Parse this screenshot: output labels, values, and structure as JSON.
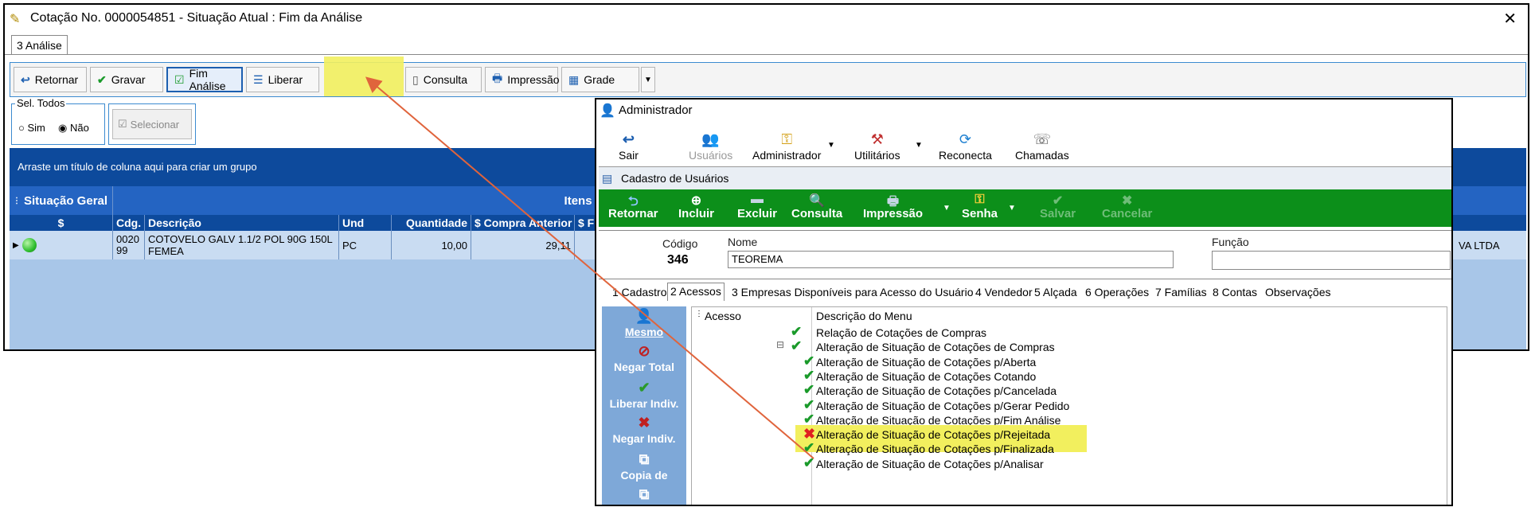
{
  "main": {
    "title": "Cotação No. 0000054851 - Situação Atual : Fim da Análise",
    "close": "✕",
    "tab": "3 Análise",
    "toolbar": {
      "retornar": "Retornar",
      "gravar": "Gravar",
      "fim_analise": "Fim Análise",
      "liberar": "Liberar",
      "consulta": "Consulta",
      "impressao": "Impressão",
      "grade": "Grade"
    },
    "sel_todos": {
      "legend": "Sel. Todos",
      "sim": "Sim",
      "nao": "Não",
      "selected": "Não"
    },
    "selecionar": "Selecionar",
    "grid": {
      "group_hint": "Arraste um título de coluna aqui para criar um grupo",
      "band_situacao": "Situação Geral",
      "band_itens": "Itens A",
      "columns": [
        "$",
        "Cdg.",
        "Descrição",
        "Und",
        "Quantidade",
        "$ Compra Anterior",
        "$ F"
      ],
      "row": {
        "cdg": "0020 99",
        "descricao": "COTOVELO GALV 1.1/2 POL 90G 150L FEMEA",
        "und": "PC",
        "quantidade": "10,00",
        "compra_anterior": "29,11",
        "fornecedor_tail": "VA LTDA",
        "status_color": "#2fbf2f"
      }
    }
  },
  "admin": {
    "title": "Administrador",
    "toolbar": {
      "sair": "Sair",
      "usuarios": "Usuários",
      "administrador": "Administrador",
      "utilitarios": "Utilitários",
      "reconecta": "Reconecta",
      "chamadas": "Chamadas"
    }
  },
  "cadastro": {
    "title": "Cadastro de Usuários",
    "toolbar": {
      "retornar": "Retornar",
      "incluir": "Incluir",
      "excluir": "Excluir",
      "consulta": "Consulta",
      "impressao": "Impressão",
      "senha": "Senha",
      "salvar": "Salvar",
      "cancelar": "Cancelar"
    },
    "fields": {
      "codigo_label": "Código",
      "codigo_value": "346",
      "nome_label": "Nome",
      "nome_value": "TEOREMA",
      "funcao_label": "Função",
      "funcao_value": ""
    },
    "tabs": [
      "1 Cadastro",
      "2 Acessos",
      "3 Empresas Disponíveis para Acesso do Usuário",
      "4 Vendedor",
      "5 Alçada",
      "6 Operações",
      "7 Famílias",
      "8 Contas",
      "Observações"
    ],
    "side": [
      "Mesmo",
      "Negar Total",
      "Liberar Indiv.",
      "Negar Indiv.",
      "Copia de"
    ],
    "tree": {
      "col_acesso": "Acesso",
      "col_descricao": "Descrição do Menu",
      "rows": [
        {
          "text": "Relação de Cotações de Compras",
          "status": "ok"
        },
        {
          "text": "Alteração de Situação de Cotações de Compras",
          "status": "ok"
        },
        {
          "text": "Alteração de Situação de Cotações p/Aberta",
          "status": "ok"
        },
        {
          "text": "Alteração de Situação de Cotações Cotando",
          "status": "ok"
        },
        {
          "text": "Alteração de Situação de Cotações p/Cancelada",
          "status": "ok"
        },
        {
          "text": "Alteração de Situação de Cotações p/Gerar Pedido",
          "status": "ok"
        },
        {
          "text": "Alteração de Situação de Cotações p/Fim Análise",
          "status": "ok"
        },
        {
          "text": "Alteração de Situação de Cotações p/Rejeitada",
          "status": "denied"
        },
        {
          "text": "Alteração de Situação de Cotações p/Finalizada",
          "status": "ok"
        },
        {
          "text": "Alteração de Situação de Cotações p/Analisar",
          "status": "ok"
        }
      ]
    }
  },
  "colors": {
    "highlight": "#f2ef5e",
    "arrow": "#e0643c",
    "grid_dark": "#0d4a9c",
    "green_bar": "#0c8f1a"
  }
}
